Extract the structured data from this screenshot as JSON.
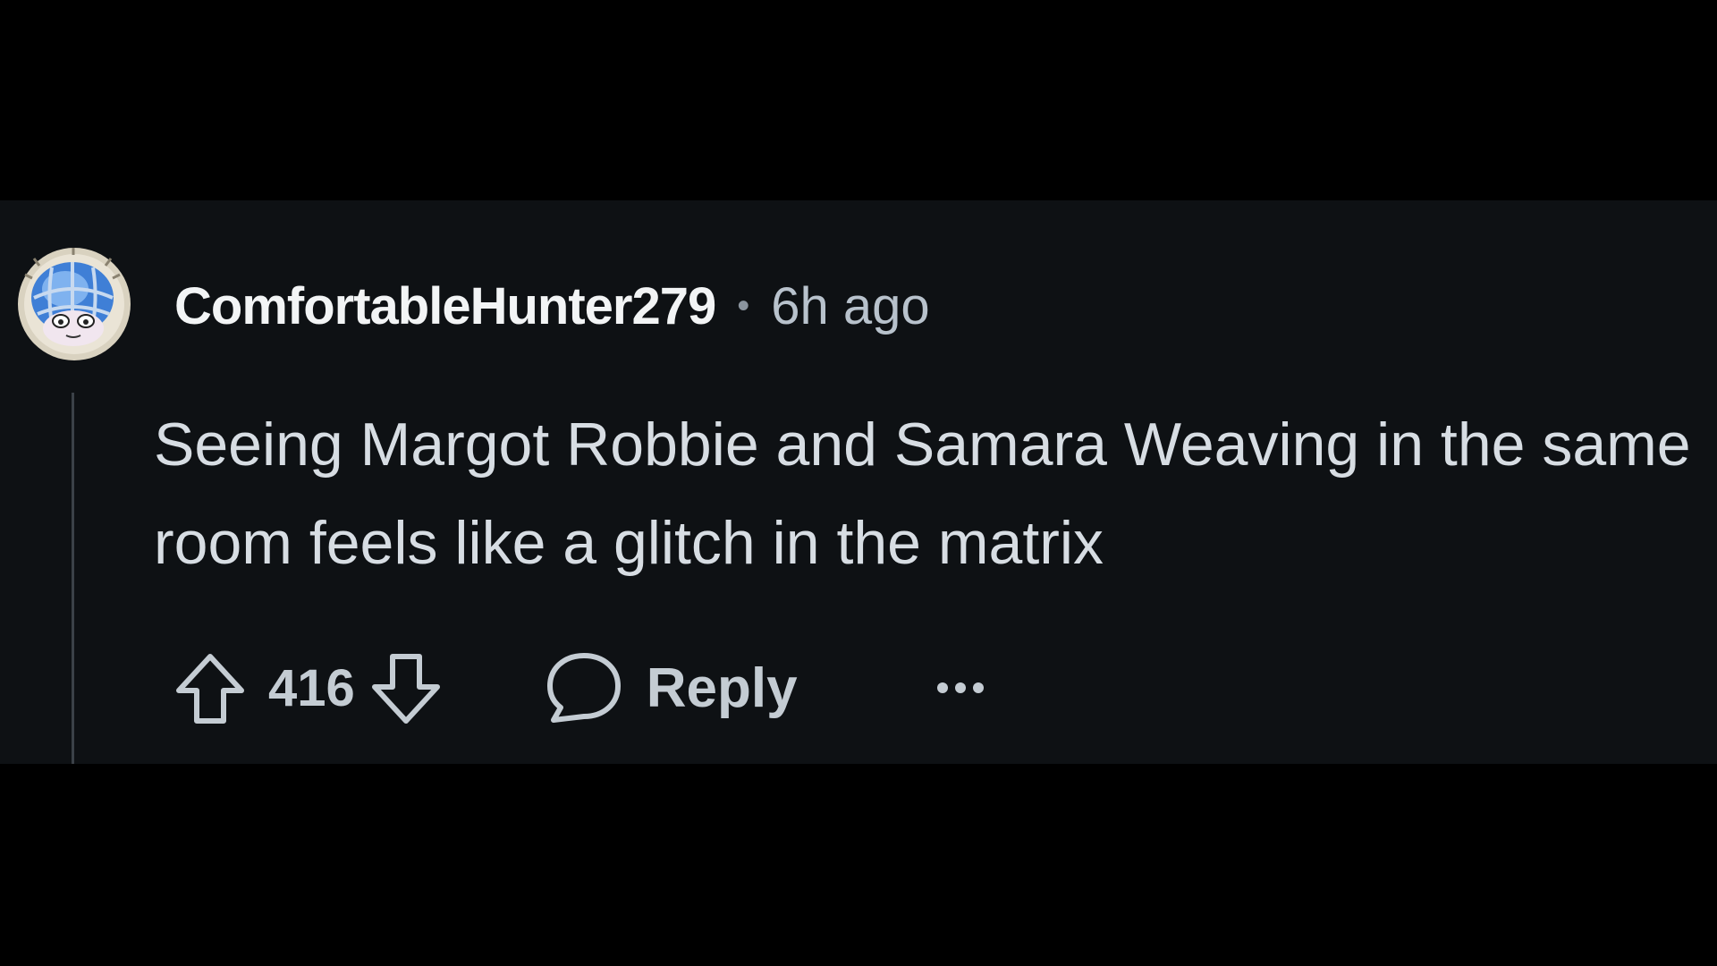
{
  "comment": {
    "author": "ComfortableHunter279",
    "separator": "•",
    "timestamp": "6h ago",
    "body": "Seeing Margot Robbie and Samara Weaving in the same room feels like a glitch in the matrix",
    "vote_count": "416",
    "reply_label": "Reply"
  },
  "icons": {
    "avatar": "avatar-globe-face",
    "upvote": "arrow-up-outline-icon",
    "downvote": "arrow-down-outline-icon",
    "reply": "speech-bubble-icon",
    "more": "ellipsis-icon"
  },
  "colors": {
    "page_background": "#000000",
    "panel_background": "#0e1114",
    "username": "#f2f4f5",
    "meta_text": "#b8c2cc",
    "body_text": "#d7dde3",
    "icon_stroke": "#c4ccd3",
    "thread_line": "#3b4148"
  }
}
